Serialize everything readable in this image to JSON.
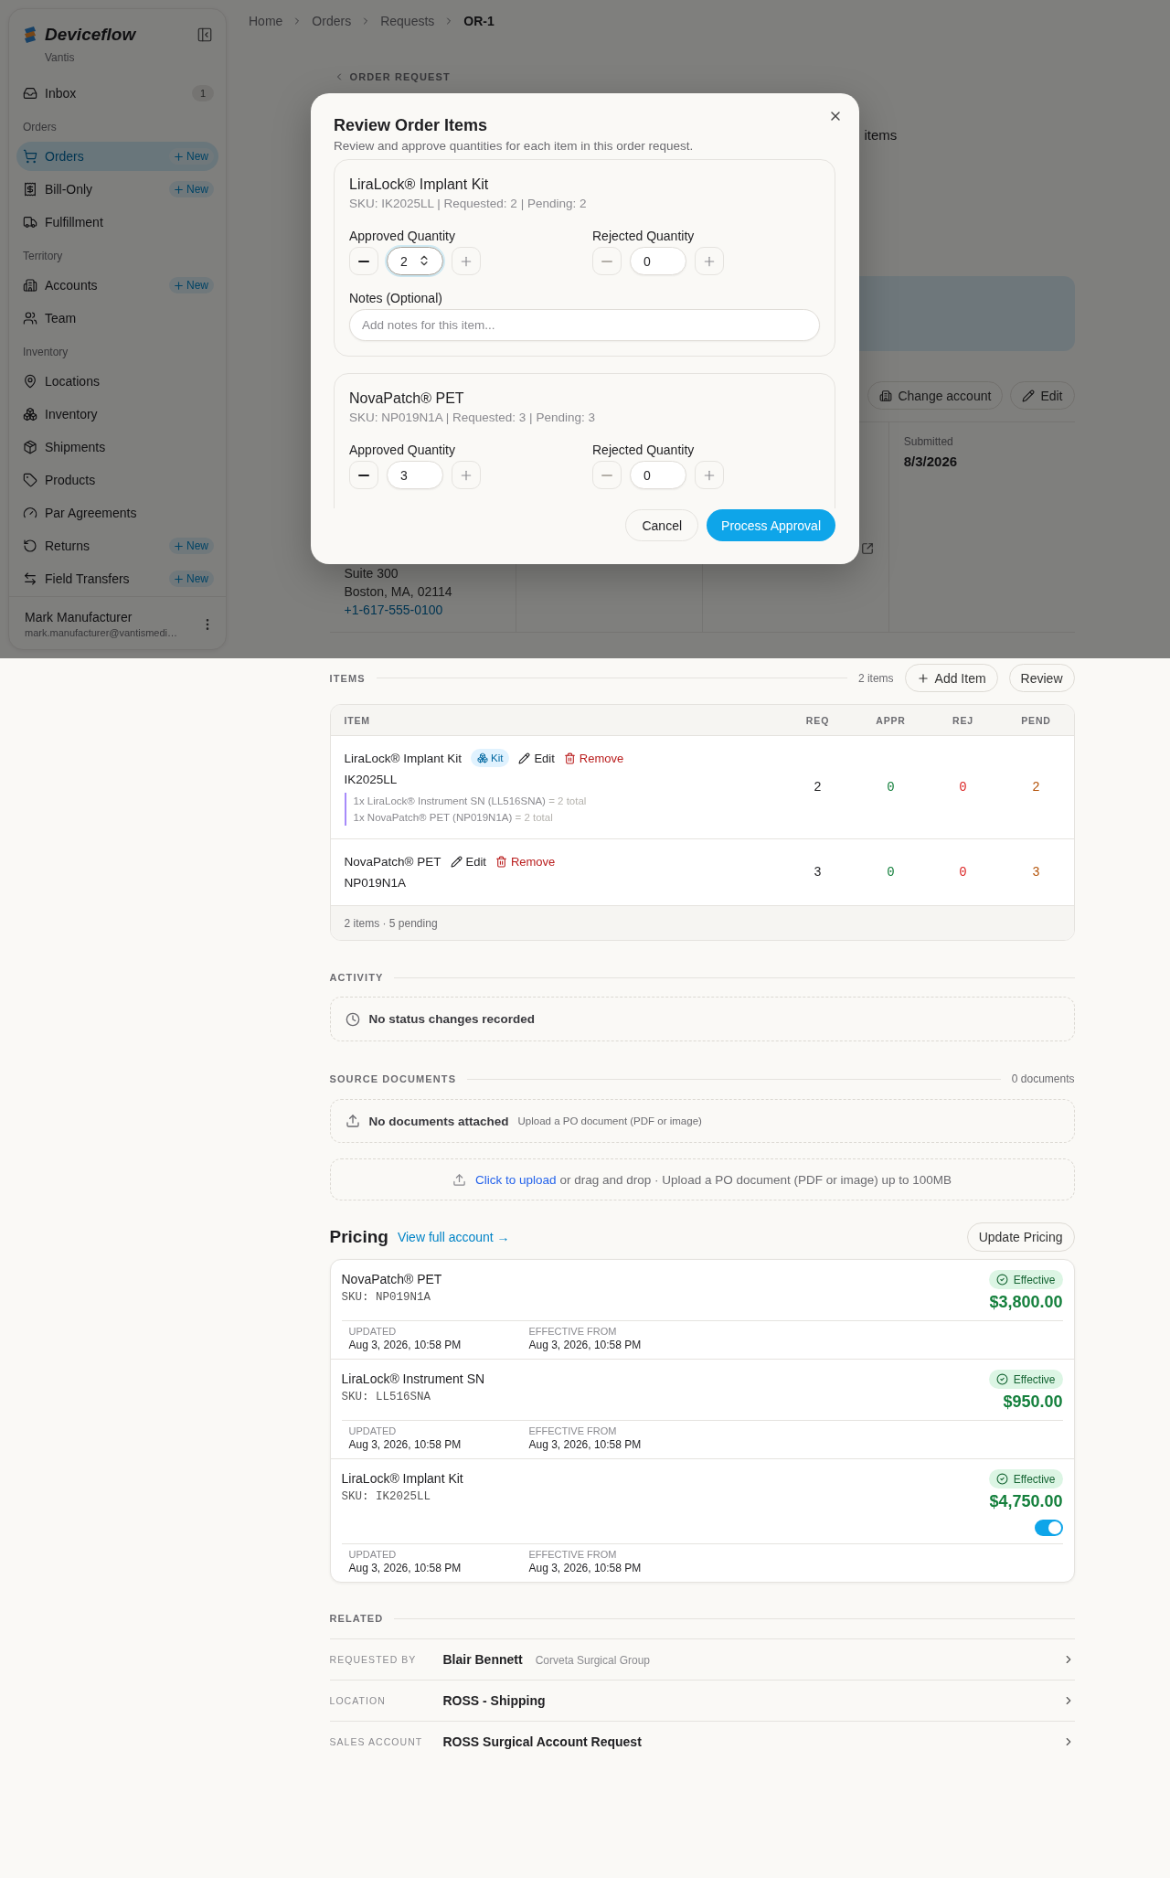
{
  "sidebar": {
    "brand": "Deviceflow",
    "org": "Vantis",
    "inbox": {
      "label": "Inbox",
      "count": "1"
    },
    "sections": [
      {
        "title": "Orders",
        "items": [
          {
            "label": "Orders",
            "selected": true,
            "badge": "New"
          },
          {
            "label": "Bill-Only",
            "selected": false,
            "badge": "New"
          },
          {
            "label": "Fulfillment",
            "selected": false
          }
        ]
      },
      {
        "title": "Territory",
        "items": [
          {
            "label": "Accounts",
            "selected": false,
            "badge": "New"
          },
          {
            "label": "Team",
            "selected": false
          }
        ]
      },
      {
        "title": "Inventory",
        "items": [
          {
            "label": "Locations",
            "selected": false
          },
          {
            "label": "Inventory",
            "selected": false
          },
          {
            "label": "Shipments",
            "selected": false
          },
          {
            "label": "Products",
            "selected": false
          },
          {
            "label": "Par Agreements",
            "selected": false
          },
          {
            "label": "Returns",
            "selected": false,
            "badge": "New"
          },
          {
            "label": "Field Transfers",
            "selected": false,
            "badge": "New"
          }
        ]
      }
    ],
    "user": {
      "name": "Mark Manufacturer",
      "email": "mark.manufacturer@vantismedi…"
    }
  },
  "breadcrumbs": [
    {
      "label": "Home",
      "current": false
    },
    {
      "label": "Orders",
      "current": false
    },
    {
      "label": "Requests",
      "current": false
    },
    {
      "label": "OR-1",
      "current": true
    }
  ],
  "order": {
    "back_link": "ORDER REQUEST",
    "header_fragment": "items",
    "actions": [
      "Change account",
      "Edit"
    ],
    "address_lines": [
      "Suite 300",
      "Boston, MA, 02114"
    ],
    "phone": "+1-617-555-0100",
    "submitted_label": "Submitted",
    "submitted": "8/3/2026"
  },
  "modal": {
    "title": "Review Order Items",
    "subtitle": "Review and approve quantities for each item in this order request.",
    "items": [
      {
        "name": "LiraLock® Implant Kit",
        "meta": "SKU: IK2025LL | Requested: 2 | Pending: 2",
        "approved": {
          "label": "Approved Quantity",
          "value": "2",
          "focused": true,
          "decrement_disabled": false
        },
        "rejected": {
          "label": "Rejected Quantity",
          "value": "0",
          "focused": false,
          "decrement_disabled": true
        },
        "notes_label": "Notes (Optional)",
        "notes_placeholder": "Add notes for this item..."
      },
      {
        "name": "NovaPatch® PET",
        "meta": "SKU: NP019N1A | Requested: 3 | Pending: 3",
        "approved": {
          "label": "Approved Quantity",
          "value": "3",
          "focused": false,
          "decrement_disabled": false
        },
        "rejected": {
          "label": "Rejected Quantity",
          "value": "0",
          "focused": false,
          "decrement_disabled": true
        }
      }
    ],
    "cancel": "Cancel",
    "confirm": "Process Approval"
  },
  "items": {
    "title": "ITEMS",
    "count": "2 items",
    "add": "Add Item",
    "review": "Review",
    "columns": [
      "ITEM",
      "REQ",
      "APPR",
      "REJ",
      "PEND"
    ],
    "rows": [
      {
        "name": "LiraLock® Implant Kit",
        "kit": "Kit",
        "edit": "Edit",
        "remove": "Remove",
        "sku": "IK2025LL",
        "components": [
          {
            "text": "1x LiraLock® Instrument SN (LL516SNA)",
            "total": "= 2 total"
          },
          {
            "text": "1x NovaPatch® PET (NP019N1A)",
            "total": "= 2 total"
          }
        ],
        "req": "2",
        "appr": "0",
        "rej": "0",
        "pend": "2"
      },
      {
        "name": "NovaPatch® PET",
        "edit": "Edit",
        "remove": "Remove",
        "sku": "NP019N1A",
        "req": "3",
        "appr": "0",
        "rej": "0",
        "pend": "3"
      }
    ],
    "footer": "2 items · 5 pending"
  },
  "activity": {
    "title": "ACTIVITY",
    "empty": "No status changes recorded"
  },
  "documents": {
    "title": "SOURCE DOCUMENTS",
    "count": "0 documents",
    "empty_title": "No documents attached",
    "empty_hint": "Upload a PO document (PDF or image)",
    "upload_link": "Click to upload",
    "upload_text": "or drag and drop · Upload a PO document (PDF or image) up to 100MB"
  },
  "pricing": {
    "title": "Pricing",
    "link": "View full account →",
    "button": "Update Pricing",
    "items": [
      {
        "name": "NovaPatch® PET",
        "sku": "SKU: NP019N1A",
        "status": "Effective",
        "price": "$3,800.00",
        "updated_label": "UPDATED",
        "updated": "Aug 3, 2026, 10:58 PM",
        "effective_label": "EFFECTIVE FROM",
        "effective": "Aug 3, 2026, 10:58 PM"
      },
      {
        "name": "LiraLock® Instrument SN",
        "sku": "SKU: LL516SNA",
        "status": "Effective",
        "price": "$950.00",
        "updated_label": "UPDATED",
        "updated": "Aug 3, 2026, 10:58 PM",
        "effective_label": "EFFECTIVE FROM",
        "effective": "Aug 3, 2026, 10:58 PM"
      },
      {
        "name": "LiraLock® Implant Kit",
        "sku": "SKU: IK2025LL",
        "status": "Effective",
        "price": "$4,750.00",
        "switch": {
          "on": true
        },
        "updated_label": "UPDATED",
        "updated": "Aug 3, 2026, 10:58 PM",
        "effective_label": "EFFECTIVE FROM",
        "effective": "Aug 3, 2026, 10:58 PM"
      }
    ]
  },
  "related": {
    "title": "RELATED",
    "rows": [
      {
        "label": "REQUESTED BY",
        "value": "Blair Bennett",
        "secondary": "Corveta Surgical Group"
      },
      {
        "label": "LOCATION",
        "value": "ROSS - Shipping"
      },
      {
        "label": "SALES ACCOUNT",
        "value": "ROSS Surgical Account Request"
      }
    ]
  }
}
